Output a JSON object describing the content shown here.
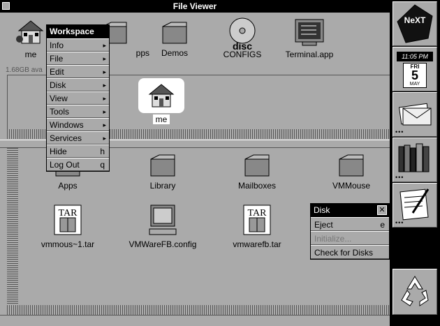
{
  "window": {
    "title": "File Viewer"
  },
  "shelf": {
    "disk_info": "1.68GB ava",
    "items": [
      {
        "label": "me",
        "icon": "home-icon"
      },
      {
        "label": "pps",
        "icon": "folder-icon"
      },
      {
        "label": "Demos",
        "icon": "folder-icon"
      },
      {
        "label": "CONFIGS",
        "icon": "disc-icon"
      },
      {
        "label": "Terminal.app",
        "icon": "terminal-icon"
      }
    ]
  },
  "browser": {
    "selected": {
      "label": "me",
      "icon": "home-icon"
    }
  },
  "files": [
    {
      "label": "Apps",
      "icon": "folder-icon"
    },
    {
      "label": "Library",
      "icon": "folder-icon"
    },
    {
      "label": "Mailboxes",
      "icon": "folder-icon"
    },
    {
      "label": "VMMouse",
      "icon": "folder-icon"
    },
    {
      "label": "vmmous~1.tar",
      "icon": "tar-icon"
    },
    {
      "label": "VMWareFB.config",
      "icon": "computer-icon"
    },
    {
      "label": "vmwarefb.tar",
      "icon": "tar-icon"
    }
  ],
  "menu": {
    "title": "Workspace",
    "items": [
      {
        "label": "Info",
        "submenu": true
      },
      {
        "label": "File",
        "submenu": true
      },
      {
        "label": "Edit",
        "submenu": true
      },
      {
        "label": "Disk",
        "submenu": true
      },
      {
        "label": "View",
        "submenu": true
      },
      {
        "label": "Tools",
        "submenu": true
      },
      {
        "label": "Windows",
        "submenu": true
      },
      {
        "label": "Services",
        "submenu": true
      },
      {
        "label": "Hide",
        "key": "h"
      },
      {
        "label": "Log Out",
        "key": "q"
      }
    ]
  },
  "disk_menu": {
    "title": "Disk",
    "items": [
      {
        "label": "Eject",
        "key": "e",
        "enabled": true
      },
      {
        "label": "Initialize...",
        "enabled": false
      },
      {
        "label": "Check for Disks",
        "enabled": true
      }
    ]
  },
  "dock": {
    "logo": "NeXT",
    "clock": {
      "time": "11:05 PM",
      "weekday": "FRI",
      "day": "5",
      "month": "MAY"
    },
    "tiles": [
      "next-logo-icon",
      "clock-icon",
      "mail-icon",
      "books-icon",
      "editor-icon",
      "recycler-icon"
    ]
  },
  "colors": {
    "gray": "#aaaaaa",
    "dark": "#555555",
    "black": "#000000",
    "white": "#ffffff"
  }
}
